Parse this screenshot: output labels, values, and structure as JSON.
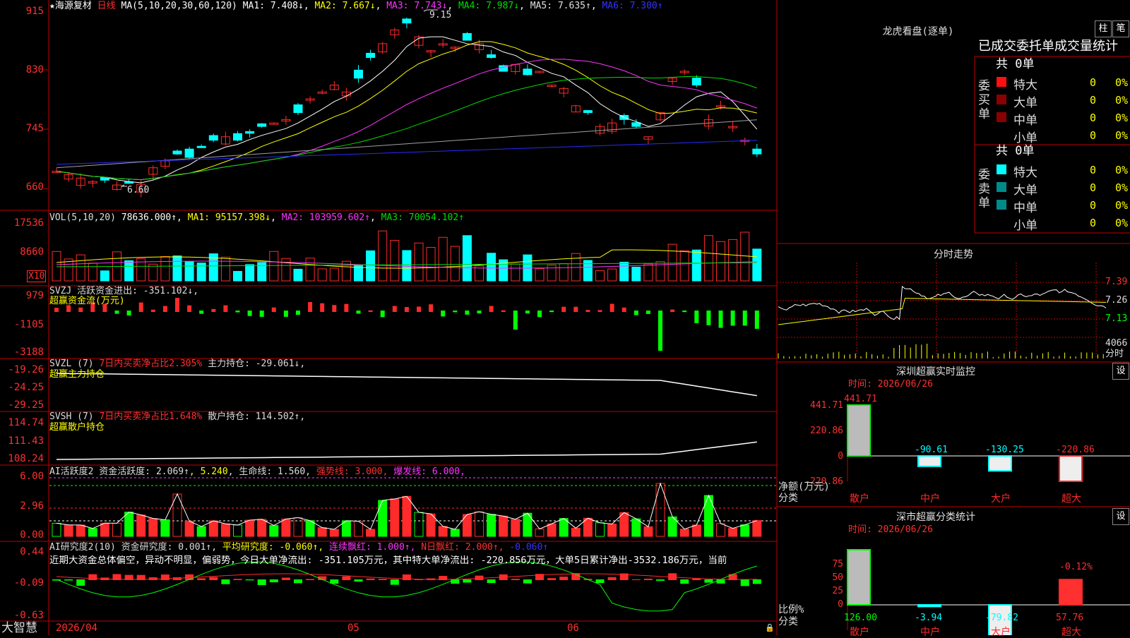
{
  "colors": {
    "up": "#ff2a2a",
    "down": "#00ffff",
    "grid": "#c00000",
    "ma1": "#ffffff",
    "ma2": "#ffff00",
    "ma3": "#ff33ff",
    "ma4": "#00dd00",
    "ma5": "#a0a0a0",
    "ma6": "#2a2aff",
    "green": "#00ff00",
    "magenta": "#ff44ff"
  },
  "header": {
    "star": "★",
    "stock": "海源复材",
    "period": "日线",
    "ma_label": "MA(5,10,20,30,60,120)",
    "ma": [
      {
        "label": "MA1: 7.408↓"
      },
      {
        "label": "MA2: 7.667↓"
      },
      {
        "label": "MA3: 7.743↓"
      },
      {
        "label": "MA4: 7.987↓"
      },
      {
        "label": "MA5: 7.635↑"
      },
      {
        "label": "MA6: 7.300↑"
      }
    ]
  },
  "price_axis": [
    "915",
    "830",
    "745",
    "660"
  ],
  "price_marks": {
    "high": "9.15",
    "low": "6.60"
  },
  "vol": {
    "label": "VOL(5,10,20)",
    "value": "78636.000↑",
    "ma1": "MA1: 95157.398↓",
    "ma2": "MA2: 103959.602↑",
    "ma3": "MA3: 70054.102↑",
    "axis": [
      "17536",
      "8660"
    ],
    "unit": "X10"
  },
  "svzj": {
    "line1": "SVZJ  活跃资金进出: -351.102↓,",
    "line2": "超赢资金流(万元)",
    "axis": [
      "979",
      "-1105",
      "-3188"
    ]
  },
  "svzl": {
    "line1a": "SVZL (7) ",
    "line1b": "7日内买卖净占比2.305%",
    "line1c": " 主力持仓: -29.061↓,",
    "line2": "超赢主力持仓",
    "axis": [
      "-19.26",
      "-24.25",
      "-29.25"
    ]
  },
  "svsh": {
    "line1a": "SVSH (7) ",
    "line1b": "7日内买卖净占比1.648%",
    "line1c": " 散户持仓: 114.502↑,",
    "line2": "超赢散户持仓",
    "axis": [
      "114.74",
      "111.43",
      "108.24"
    ]
  },
  "ai1": {
    "a": "AI活跃度2 资金活跃度: 2.069↑",
    "b": ", 5.240",
    "c": ", 生命线: 1.560,",
    "d": " 强势线: 3.000,",
    "e": " 爆发线: 6.000,",
    "axis": [
      "6.00",
      "2.96",
      "0.00"
    ]
  },
  "ai2": {
    "a": "AI研究度2(10) 资金研究度: 0.001↑,",
    "b": " 平均研究度: -0.060↑,",
    "c": " 连续飘红: 1.000↑,",
    "d": " N日飘红: 2.000↑,",
    "e": " -0.060↑",
    "summary": "近期大资金总体偏空，异动不明显，偏弱势，今日大单净流出: -351.105万元，其中特大单净流出: -220.856万元，大单5日累计净出-3532.186万元，当前",
    "axis": [
      "0.44",
      "-0.09",
      "-0.63"
    ]
  },
  "bottom": {
    "logo": "大智慧",
    "date": "2026/04",
    "m1": "05",
    "m2": "06"
  },
  "dragon": {
    "title": "龙虎看盘(逐单)",
    "tab1": "柱",
    "tab2": "笔",
    "subtitle": "已成交委托单成交量统计",
    "buy": {
      "label": "委买单",
      "total": "共 0单",
      "rows": [
        {
          "name": "特大",
          "v": "0",
          "p": "0%"
        },
        {
          "name": "大单",
          "v": "0",
          "p": "0%"
        },
        {
          "name": "中单",
          "v": "0",
          "p": "0%"
        },
        {
          "name": "小单",
          "v": "0",
          "p": "0%"
        }
      ]
    },
    "sell": {
      "label": "委卖单",
      "total": "共 0单",
      "rows": [
        {
          "name": "特大",
          "v": "0",
          "p": "0%"
        },
        {
          "name": "大单",
          "v": "0",
          "p": "0%"
        },
        {
          "name": "中单",
          "v": "0",
          "p": "0%"
        },
        {
          "name": "小单",
          "v": "0",
          "p": "0%"
        }
      ]
    }
  },
  "timeshare": {
    "title": "分时走势",
    "axis": [
      "7.39",
      "7.26",
      "7.13"
    ],
    "vol": "4066",
    "vlabel": "分时"
  },
  "monitor": {
    "title": "深圳超赢实时监控",
    "btn": "设",
    "time": "时间: 2026/06/26",
    "axis": [
      "441.71",
      "220.86",
      "0",
      "-220.86"
    ],
    "ylabel1": "净额(万元)",
    "ylabel2": "分类",
    "bars": [
      {
        "cat": "散户",
        "v": 441.71,
        "label": "441.71"
      },
      {
        "cat": "中户",
        "v": -90.61,
        "label": "-90.61"
      },
      {
        "cat": "大户",
        "v": -130.25,
        "label": "-130.25"
      },
      {
        "cat": "超大",
        "v": -220.86,
        "label": "-220.86"
      }
    ]
  },
  "classify": {
    "title": "深市超赢分类统计",
    "btn": "设",
    "time": "时间: 2026/06/26",
    "axis": [
      "75",
      "50",
      "25",
      "0"
    ],
    "ylabel1": "比例%",
    "ylabel2": "分类",
    "top_label": "-0.12%",
    "bars": [
      {
        "cat": "散户",
        "v": 126.0,
        "label": "126.00"
      },
      {
        "cat": "中户",
        "v": -3.94,
        "label": "-3.94"
      },
      {
        "cat": "大户",
        "v": -79.82,
        "label": "-79.82"
      },
      {
        "cat": "超大",
        "v": 57.76,
        "label": "57.76"
      }
    ]
  }
}
